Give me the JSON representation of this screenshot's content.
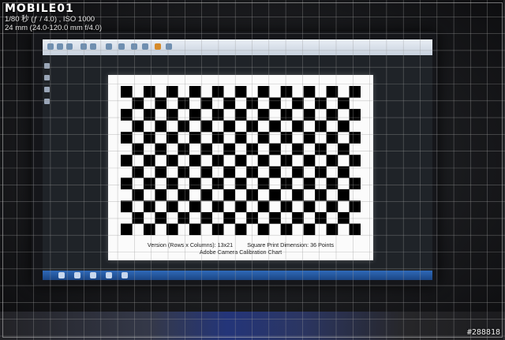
{
  "watermark": {
    "logo": "MOBILE01",
    "exposure": "1/80 秒 (ƒ / 4.0) , ISO 1000",
    "lens": "24 mm (24.0-120.0 mm f/4.0)",
    "photo_id": "#288818"
  },
  "calibration_chart": {
    "version_text": "Version (Rows x Columns): 13x21",
    "dimension_text": "Square Print Dimension: 36 Points",
    "chart_title": "Adobe Camera Calibration Chart",
    "rows": 13,
    "columns": 21
  },
  "colors": {
    "grid_line": "#9a9a9a",
    "taskbar": "#2f69b8",
    "chart_background": "#fbfbfb",
    "square": "#000000"
  }
}
